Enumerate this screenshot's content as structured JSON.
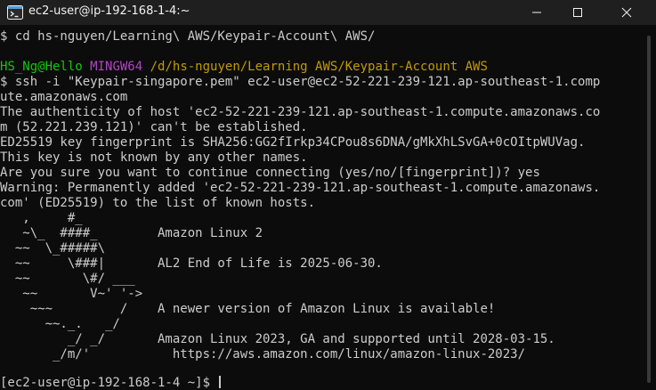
{
  "window": {
    "title": "ec2-user@ip-192-168-1-4:~",
    "icon": "git-bash-icon",
    "controls": [
      "minimize-icon",
      "maximize-icon",
      "close-icon"
    ]
  },
  "terminal": {
    "cd_command": "$ cd hs-nguyen/Learning\\ AWS/Keypair-Account\\ AWS/",
    "prompt": {
      "user_host": "HS_Ng@Hello",
      "shell": "MINGW64",
      "path": "/d/hs-nguyen/Learning AWS/Keypair-Account AWS"
    },
    "ssh_command_1": "$ ssh -i \"Keypair-singapore.pem\" ec2-user@ec2-52-221-239-121.ap-southeast-1.comp",
    "ssh_command_2": "ute.amazonaws.com",
    "auth_1": "The authenticity of host 'ec2-52-221-239-121.ap-southeast-1.compute.amazonaws.co",
    "auth_2": "m (52.221.239.121)' can't be established.",
    "fingerprint": "ED25519 key fingerprint is SHA256:GG2fIrkp34CPou8s6DNA/gMkXhLSvGA+0cOItpWUVag.",
    "not_known": "This key is not known by any other names.",
    "confirm": "Are you sure you want to continue connecting (yes/no/[fingerprint])? yes",
    "warning_1": "Warning: Permanently added 'ec2-52-221-239-121.ap-southeast-1.compute.amazonaws.",
    "warning_2": "com' (ED25519) to the list of known hosts.",
    "motd": [
      "   ,     #_",
      "   ~\\_  ####_        Amazon Linux 2",
      "  ~~  \\_#####\\",
      "  ~~     \\###|       AL2 End of Life is 2025-06-30.",
      "  ~~       \\#/ ___",
      "   ~~       V~' '->",
      "    ~~~         /    A newer version of Amazon Linux is available!",
      "      ~~._.   _/",
      "         _/ _/       Amazon Linux 2023, GA and supported until 2028-03-15.",
      "       _/m/'           https://aws.amazon.com/linux/amazon-linux-2023/"
    ],
    "final_prompt": "[ec2-user@ip-192-168-1-4 ~]$ "
  }
}
